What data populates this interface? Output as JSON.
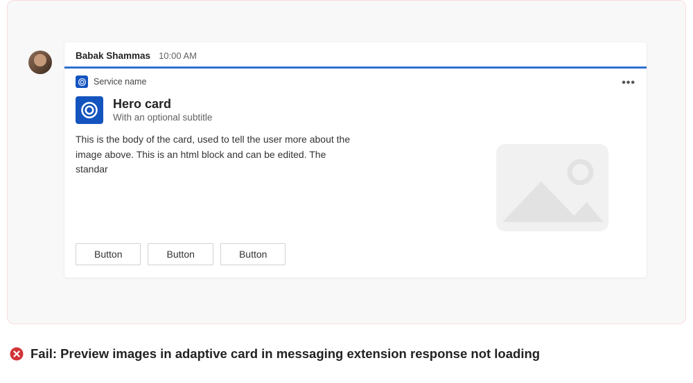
{
  "message": {
    "sender": "Babak Shammas",
    "timestamp": "10:00 AM"
  },
  "card": {
    "service_name": "Service name",
    "title": "Hero card",
    "subtitle": "With an optional subtitle",
    "body": "This is the body of the card, used to tell the user more about the image above. This is an html block and can be edited. The standar",
    "more_label": "•••",
    "buttons": [
      "Button",
      "Button",
      "Button"
    ],
    "image_placeholder": "image-not-loaded",
    "icon": "service-circle-icon"
  },
  "caption": {
    "status": "fail",
    "text": "Fail: Preview images in adaptive card in messaging extension response not loading"
  },
  "colors": {
    "accent": "#2f70d0",
    "brand": "#1454bf",
    "error": "#d13438"
  }
}
